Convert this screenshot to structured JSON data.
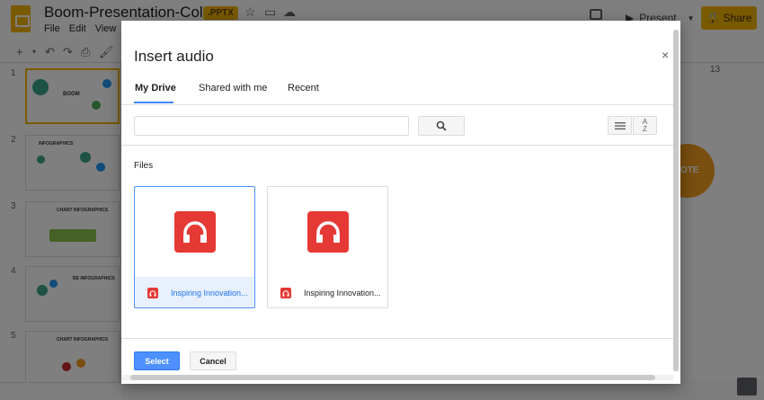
{
  "app": {
    "title": "Boom-Presentation-Colorful",
    "badge": ".PPTX",
    "menu": [
      "File",
      "Edit",
      "View"
    ],
    "present_label": "Present",
    "share_label": "Share",
    "ruler_number": "13",
    "slide_numbers": [
      "1",
      "2",
      "3",
      "4",
      "5"
    ],
    "thumb_titles": [
      "BOOM",
      "INFOGRAPHICS",
      "CHART INFOGRAPHICS",
      "BE INFOGRAPHICS",
      "CHART INFOGRAPHICS"
    ],
    "slide_text": "OTE"
  },
  "dialog": {
    "title": "Insert audio",
    "close_glyph": "×",
    "tabs": [
      "My Drive",
      "Shared with me",
      "Recent"
    ],
    "search": {
      "value": "",
      "placeholder": ""
    },
    "sort_label_top": "A",
    "sort_label_bottom": "Z",
    "files_heading": "Files",
    "files": [
      {
        "name": "Inspiring Innovation...",
        "selected": true
      },
      {
        "name": "Inspiring Innovation...",
        "selected": false
      }
    ],
    "select_label": "Select",
    "cancel_label": "Cancel"
  },
  "colors": {
    "accent": "#f4b400",
    "audio_icon": "#e53935",
    "primary_button": "#4d90fe",
    "tab_underline": "#4285f4"
  }
}
